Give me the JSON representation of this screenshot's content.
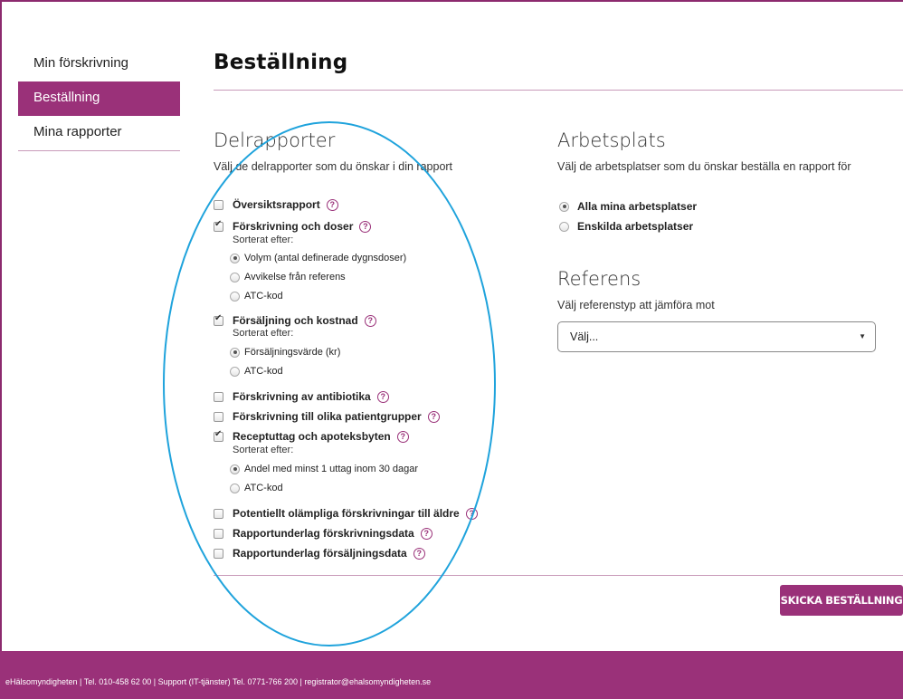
{
  "sidebar": {
    "items": [
      {
        "label": "Min förskrivning"
      },
      {
        "label": "Beställning"
      },
      {
        "label": "Mina rapporter"
      }
    ]
  },
  "page": {
    "title": "Beställning"
  },
  "delrapporter": {
    "title": "Delrapporter",
    "description": "Välj de delrapporter som du önskar i din rapport",
    "sort_label": "Sorterat efter:",
    "items": [
      {
        "label": "Översiktsrapport",
        "checked": false
      },
      {
        "label": "Förskrivning och doser",
        "checked": true,
        "options": [
          {
            "label": "Volym (antal definerade dygnsdoser)",
            "selected": true
          },
          {
            "label": "Avvikelse från referens",
            "selected": false
          },
          {
            "label": "ATC-kod",
            "selected": false
          }
        ]
      },
      {
        "label": "Försäljning och kostnad",
        "checked": true,
        "options": [
          {
            "label": "Försäljningsvärde (kr)",
            "selected": true
          },
          {
            "label": "ATC-kod",
            "selected": false
          }
        ]
      },
      {
        "label": "Förskrivning av antibiotika",
        "checked": false
      },
      {
        "label": "Förskrivning till olika patientgrupper",
        "checked": false
      },
      {
        "label": "Receptuttag och apoteksbyten",
        "checked": true,
        "options": [
          {
            "label": "Andel med minst 1 uttag inom 30 dagar",
            "selected": true
          },
          {
            "label": "ATC-kod",
            "selected": false
          }
        ]
      },
      {
        "label": "Potentiellt olämpliga förskrivningar till äldre",
        "checked": false
      },
      {
        "label": "Rapportunderlag förskrivningsdata",
        "checked": false
      },
      {
        "label": "Rapportunderlag försäljningsdata",
        "checked": false
      }
    ]
  },
  "arbetsplats": {
    "title": "Arbetsplats",
    "description": "Välj de arbetsplatser som du önskar beställa en rapport för",
    "options": [
      {
        "label": "Alla mina arbetsplatser",
        "selected": true
      },
      {
        "label": "Enskilda arbetsplatser",
        "selected": false
      }
    ]
  },
  "referens": {
    "title": "Referens",
    "description": "Välj referenstyp att jämföra mot",
    "select_value": "Välj..."
  },
  "submit_label": "SKICKA BESTÄLLNING",
  "footer": {
    "text": "eHälsomyndigheten | Tel. 010-458 62 00 | Support (IT-tjänster) Tel. 0771-766 200 | registrator@ehalsomyndigheten.se"
  },
  "colors": {
    "brand": "#9a3179",
    "annotation": "#1fa3dc"
  }
}
